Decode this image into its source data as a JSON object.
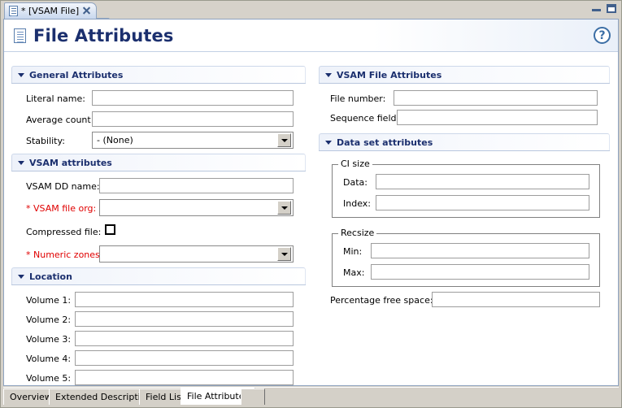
{
  "window": {
    "editor_tab": {
      "label": "* [VSAM File]",
      "icon": "document-icon",
      "close_icon": "close-icon"
    },
    "minimize_icon": "minimize-icon",
    "maximize_icon": "maximize-icon"
  },
  "form": {
    "title": "File Attributes",
    "title_icon": "document-icon",
    "help_icon": "help-icon"
  },
  "sections": {
    "general": {
      "title": "General Attributes",
      "fields": {
        "literal_name": {
          "label": "Literal name:",
          "value": ""
        },
        "average_count": {
          "label": "Average count:",
          "value": ""
        },
        "stability": {
          "label": "Stability:",
          "value": "- (None)"
        }
      }
    },
    "vsam_attributes": {
      "title": "VSAM attributes",
      "fields": {
        "dd_name": {
          "label": "VSAM DD name:",
          "value": ""
        },
        "file_org": {
          "label": "* VSAM file org:",
          "value": "",
          "required": true
        },
        "compressed": {
          "label": "Compressed file:",
          "checked": false
        },
        "numeric_zones": {
          "label": "* Numeric zones:",
          "value": "",
          "required": true
        }
      }
    },
    "location": {
      "title": "Location",
      "fields": [
        {
          "label": "Volume 1:",
          "value": ""
        },
        {
          "label": "Volume 2:",
          "value": ""
        },
        {
          "label": "Volume 3:",
          "value": ""
        },
        {
          "label": "Volume 4:",
          "value": ""
        },
        {
          "label": "Volume 5:",
          "value": ""
        }
      ]
    },
    "vsam_file_attributes": {
      "title": "VSAM File Attributes",
      "fields": {
        "file_number": {
          "label": "File number:",
          "value": ""
        },
        "sequence_field": {
          "label": "Sequence field:",
          "value": ""
        }
      }
    },
    "data_set_attributes": {
      "title": "Data set attributes",
      "ci_size": {
        "label": "CI size",
        "fields": {
          "data": {
            "label": "Data:",
            "value": ""
          },
          "index": {
            "label": "Index:",
            "value": ""
          }
        }
      },
      "recsize": {
        "label": "Recsize",
        "fields": {
          "min": {
            "label": "Min:",
            "value": ""
          },
          "max": {
            "label": "Max:",
            "value": ""
          }
        }
      },
      "percentage_free_space": {
        "label": "Percentage free space:",
        "value": ""
      }
    }
  },
  "page_tabs": [
    {
      "label": "Overview",
      "active": false
    },
    {
      "label": "Extended Description",
      "active": false
    },
    {
      "label": "Field List",
      "active": false
    },
    {
      "label": "File Attributes",
      "active": true
    }
  ],
  "colors": {
    "title_navy": "#1b2f6e",
    "required_red": "#e00000",
    "chrome_gray": "#d4d0c8",
    "accent_blue": "#3b6ea5"
  }
}
